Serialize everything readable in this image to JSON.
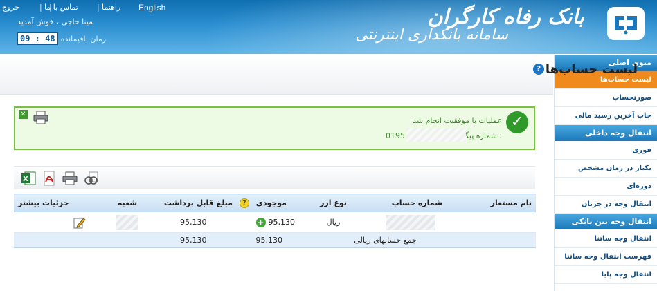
{
  "header": {
    "top_links": {
      "english": "English",
      "help": "راهنما",
      "contact": "تماس با ما",
      "exit": "خروج",
      "separator": "|"
    },
    "welcome": "مینا حاجی ، خوش آمدید",
    "remaining_label": "زمان باقیمانده",
    "timer": "09 : 48",
    "brand_bank": "بانک رفاه کارگران",
    "brand_system": "سامانه بانکداری اینترنتی"
  },
  "sidebar": {
    "sections": [
      {
        "title": "منوی اصلی",
        "items": [
          {
            "label": "لیست حساب‌ها",
            "active": true
          },
          {
            "label": "صورتحساب",
            "active": false
          },
          {
            "label": "چاپ آخرین رسید مالی",
            "active": false
          }
        ]
      },
      {
        "title": "انتقال وجه داخلی",
        "items": [
          {
            "label": "فوری",
            "active": false
          },
          {
            "label": "یکبار در زمان مشخص",
            "active": false
          },
          {
            "label": "دوره‌ای",
            "active": false
          },
          {
            "label": "انتقال وجه در جریان",
            "active": false
          }
        ]
      },
      {
        "title": "انتقال وجه بین بانکی",
        "items": [
          {
            "label": "انتقال وجه ساتنا",
            "active": false
          },
          {
            "label": "فهرست انتقال وجه ساتنا",
            "active": false
          },
          {
            "label": "انتقال وجه پایا",
            "active": false
          }
        ]
      }
    ]
  },
  "main": {
    "title": "لیست حساب‌ها",
    "help_icon": "?",
    "success": {
      "message": "عملیات با موفقیت انجام شد",
      "tracking_label": "شماره پیگیری :",
      "tracking_number": "0195"
    },
    "table": {
      "headers": [
        "نام مستعار",
        "شماره حساب",
        "نوع ارز",
        "موجودی",
        "مبلغ قابل برداشت",
        "شعبه",
        "جزئیات بیشتر"
      ],
      "rows": [
        {
          "alias": "",
          "currency": "ریال",
          "balance": "95,130",
          "withdrawable": "95,130"
        }
      ],
      "total": {
        "label": "جمع حسابهای ریالی",
        "balance": "95,130",
        "withdrawable": "95,130"
      }
    }
  },
  "icons": [
    "check-icon",
    "close-icon",
    "print-icon",
    "excel-icon",
    "pdf-icon",
    "search-icon",
    "help-icon",
    "plus-icon",
    "lamp-icon",
    "edit-icon"
  ],
  "colors": {
    "header_blue": "#1a78bb",
    "active_orange": "#f08a1c",
    "success_green": "#2f9a2a"
  }
}
